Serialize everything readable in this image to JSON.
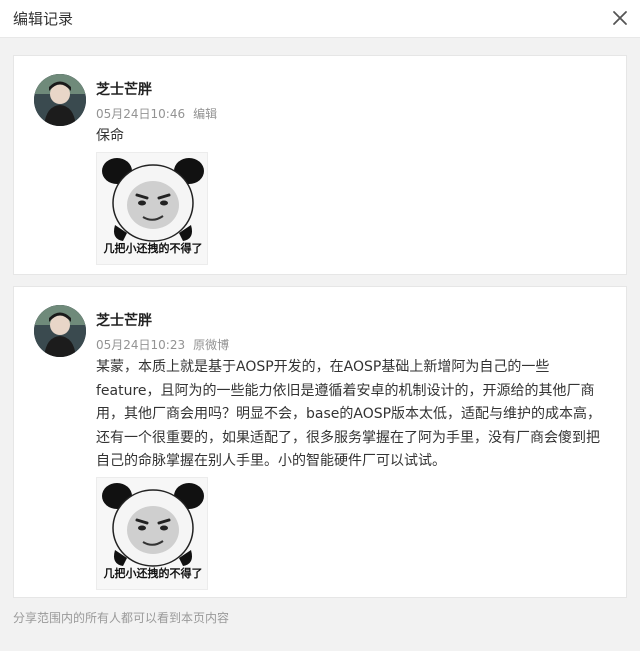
{
  "header": {
    "title": "编辑记录",
    "close_icon": "close-icon"
  },
  "posts": [
    {
      "user_name": "芝士芒胖",
      "timestamp": "05月24日10:46",
      "source": "编辑",
      "text": "保命",
      "meme_caption": "几把小还拽的不得了"
    },
    {
      "user_name": "芝士芒胖",
      "timestamp": "05月24日10:23",
      "source": "原微博",
      "text": "某蒙，本质上就是基于AOSP开发的，在AOSP基础上新增阿为自己的一些feature，且阿为的一些能力依旧是遵循着安卓的机制设计的，开源给的其他厂商用，其他厂商会用吗？明显不会，base的AOSP版本太低，适配与维护的成本高，还有一个很重要的，如果适配了，很多服务掌握在了阿为手里，没有厂商会傻到把自己的命脉掌握在别人手里。小的智能硬件厂可以试试。",
      "meme_caption": "几把小还拽的不得了"
    }
  ],
  "footer": {
    "note": "分享范围内的所有人都可以看到本页内容"
  },
  "colors": {
    "background": "#f2f2f2",
    "card": "#ffffff",
    "meta_text": "#939393"
  }
}
